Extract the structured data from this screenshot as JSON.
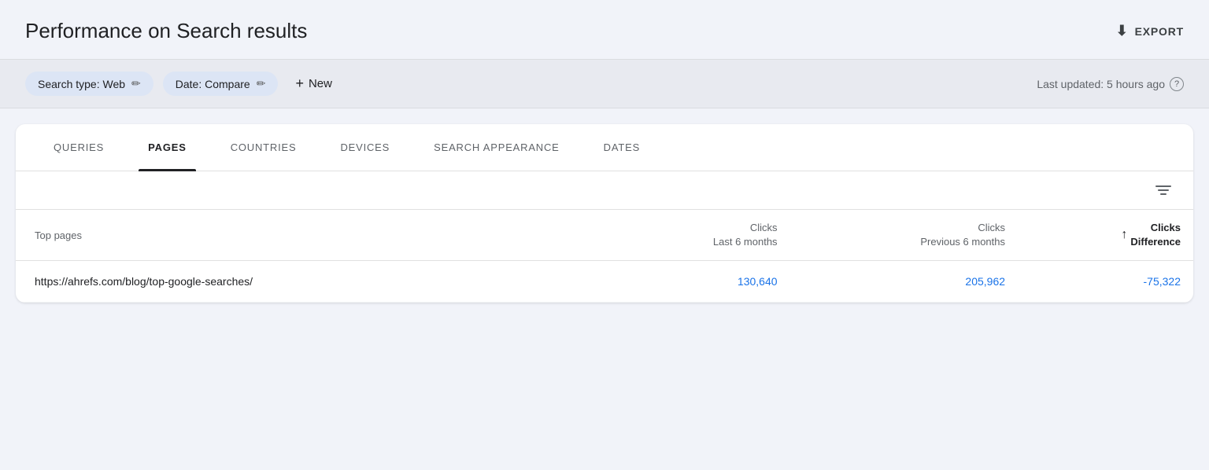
{
  "header": {
    "title": "Performance on Search results",
    "export_label": "EXPORT"
  },
  "filter_bar": {
    "chip1_label": "Search type: Web",
    "chip2_label": "Date: Compare",
    "new_label": "New",
    "last_updated": "Last updated: 5 hours ago"
  },
  "tabs": [
    {
      "id": "queries",
      "label": "QUERIES",
      "active": false
    },
    {
      "id": "pages",
      "label": "PAGES",
      "active": true
    },
    {
      "id": "countries",
      "label": "COUNTRIES",
      "active": false
    },
    {
      "id": "devices",
      "label": "DEVICES",
      "active": false
    },
    {
      "id": "search-appearance",
      "label": "SEARCH APPEARANCE",
      "active": false
    },
    {
      "id": "dates",
      "label": "DATES",
      "active": false
    }
  ],
  "table": {
    "col_page_label": "Top pages",
    "col_clicks_last_label": "Clicks",
    "col_clicks_last_sub": "Last 6 months",
    "col_clicks_prev_label": "Clicks",
    "col_clicks_prev_sub": "Previous 6 months",
    "col_diff_label": "Clicks",
    "col_diff_sub": "Difference",
    "rows": [
      {
        "page": "https://ahrefs.com/blog/top-google-searches/",
        "clicks_last": "130,640",
        "clicks_prev": "205,962",
        "clicks_diff": "-75,322"
      }
    ]
  }
}
